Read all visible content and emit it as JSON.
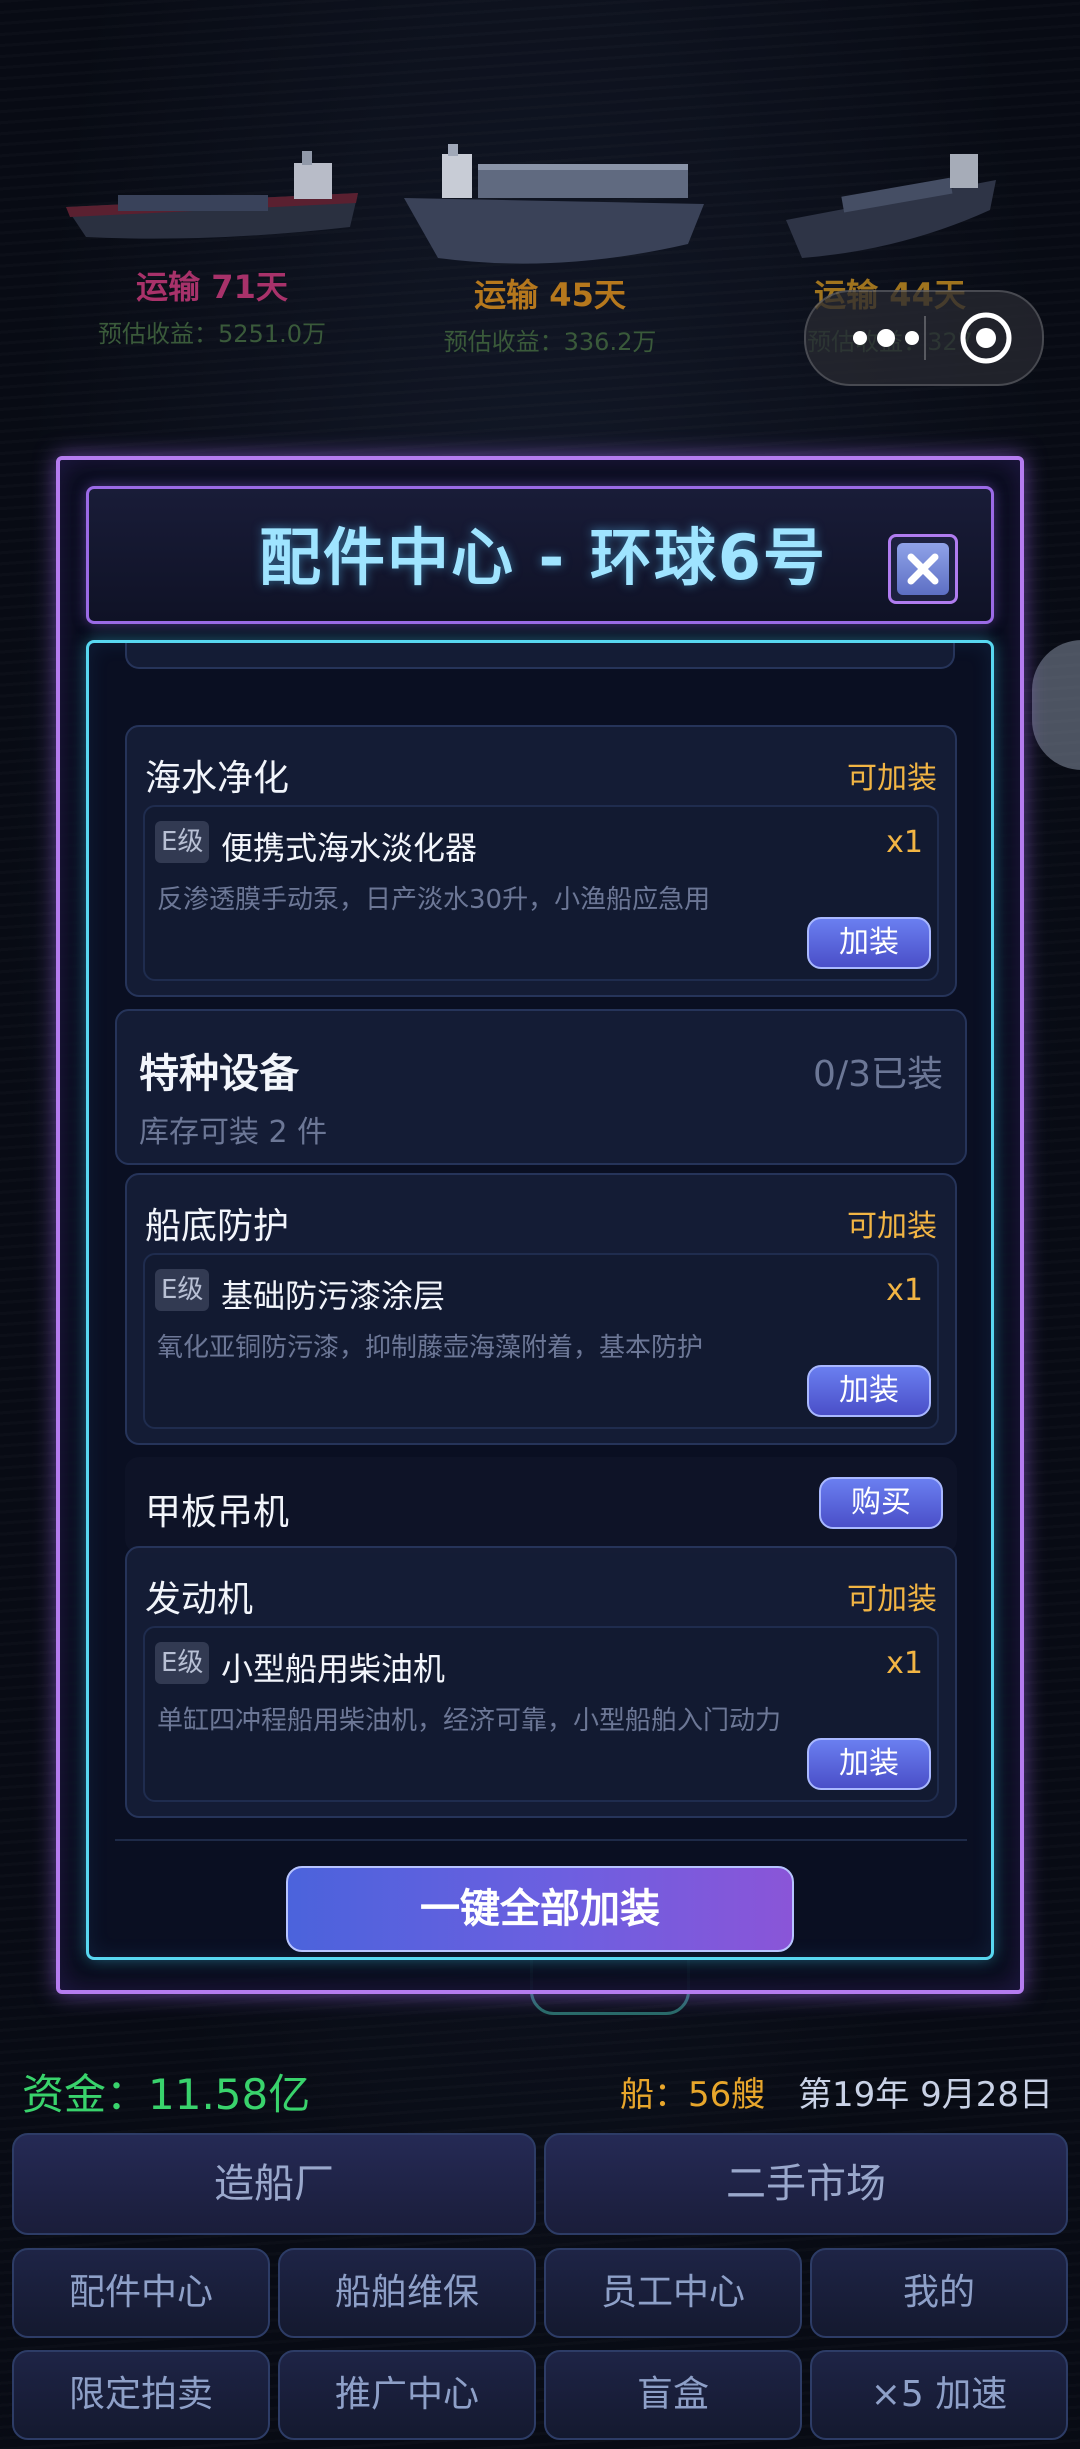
{
  "ships": [
    {
      "days": "运输 71天",
      "income": "预估收益：5251.0万",
      "color": "#a8326a"
    },
    {
      "days": "运输 45天",
      "income": "预估收益：336.2万",
      "color": "#b6781d"
    },
    {
      "days": "运输 44天",
      "income": "预估收益：327",
      "color": "#a0741e"
    }
  ],
  "dialog": {
    "title": "配件中心 - 环球6号",
    "sections": [
      {
        "title": "海水净化",
        "status": "可加装",
        "item": {
          "grade": "E级",
          "name": "便携式海水淡化器",
          "qty": "x1",
          "desc": "反渗透膜手动泵，日产淡水30升，小渔船应急用",
          "button": "加装"
        }
      },
      {
        "title": "特种设备",
        "status": "0/3已装",
        "stock": "库存可装 2 件"
      },
      {
        "title": "船底防护",
        "status": "可加装",
        "item": {
          "grade": "E级",
          "name": "基础防污漆涂层",
          "qty": "x1",
          "desc": "氧化亚铜防污漆，抑制藤壶海藻附着，基本防护",
          "button": "加装"
        }
      },
      {
        "title": "甲板吊机",
        "button": "购买"
      },
      {
        "title": "发动机",
        "status": "可加装",
        "item": {
          "grade": "E级",
          "name": "小型船用柴油机",
          "qty": "x1",
          "desc": "单缸四冲程船用柴油机，经济可靠，小型船舶入门动力",
          "button": "加装"
        }
      }
    ],
    "equip_all": "一键全部加装"
  },
  "hud": {
    "funds": "资金：11.58亿",
    "ships": "船：56艘",
    "date": "第19年 9月28日"
  },
  "menu": {
    "row1": [
      "造船厂",
      "二手市场"
    ],
    "row2": [
      "配件中心",
      "船舶维保",
      "员工中心",
      "我的"
    ],
    "row3": [
      "限定拍卖",
      "推广中心",
      "盲盒",
      "×5 加速"
    ]
  },
  "colors": {
    "accent_purple": "#b57cf0",
    "accent_cyan": "#58d7f0",
    "status_gold": "#f2b544",
    "funds_green": "#39d36c"
  },
  "icons": {
    "close": "close-icon",
    "more": "more-dots-icon",
    "capsule_close": "target-icon"
  }
}
